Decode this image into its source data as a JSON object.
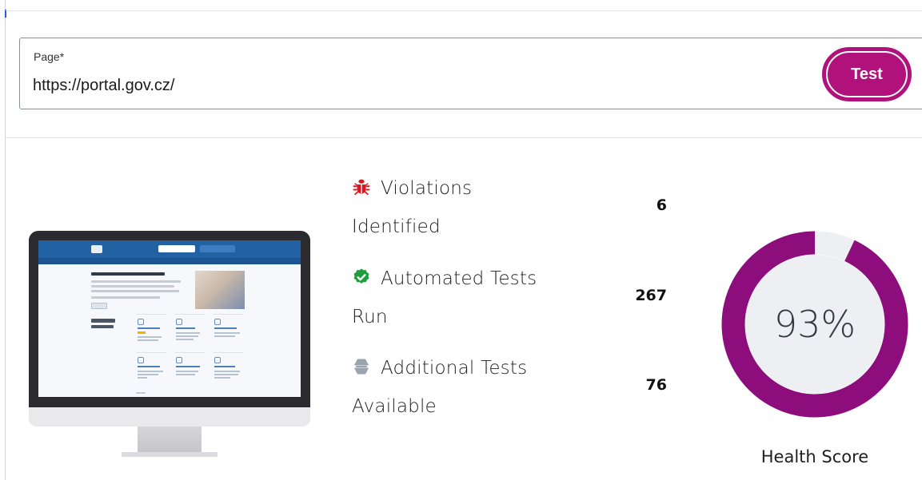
{
  "form": {
    "field_label": "Page*",
    "url_value": "https://portal.gov.cz/",
    "test_button_label": "Test"
  },
  "stats": {
    "violations": {
      "line1": "Violations",
      "line2": "Identified",
      "value": "6",
      "icon": "bug-icon",
      "color": "#e0141e"
    },
    "automated": {
      "line1": "Automated Tests",
      "line2": "Run",
      "value": "267",
      "icon": "check-badge-icon",
      "color": "#1e9e3a"
    },
    "additional": {
      "line1": "Additional Tests",
      "line2": "Available",
      "value": "76",
      "icon": "hexagon-minus-icon",
      "color": "#9aa4af"
    }
  },
  "health": {
    "percent": 93,
    "display": "93%",
    "caption": "Health Score",
    "ring_color": "#8d0d7d",
    "track_color": "#eeeff2"
  },
  "colors": {
    "accent": "#b0117a",
    "border": "#8a8f96"
  }
}
